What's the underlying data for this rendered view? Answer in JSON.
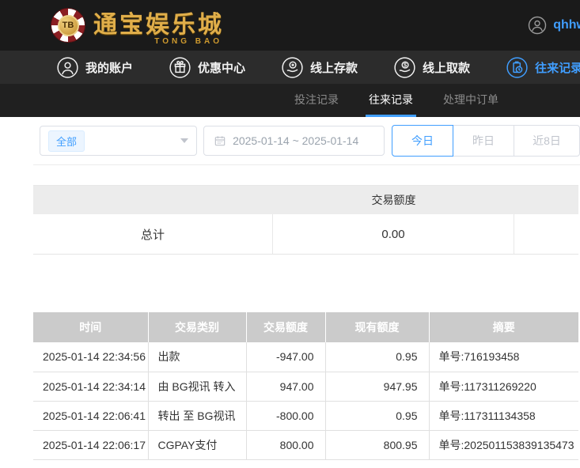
{
  "colors": {
    "accent": "#409eff",
    "gold": "#e0ae4a",
    "table_header_bg": "#cbcbcb",
    "summary_header_bg": "#ececec",
    "dark_header_bg": "#1a1a1a"
  },
  "header": {
    "logo": {
      "chip_text": "TB",
      "title": "通宝娱乐城",
      "subtitle": "TONG BAO"
    },
    "username": "qhhw"
  },
  "nav": {
    "items": [
      {
        "label": "我的账户",
        "icon": "user-icon"
      },
      {
        "label": "优惠中心",
        "icon": "gift-icon"
      },
      {
        "label": "线上存款",
        "icon": "deposit-icon"
      },
      {
        "label": "线上取款",
        "icon": "withdraw-icon"
      },
      {
        "label": "往来记录",
        "icon": "records-icon"
      }
    ],
    "bell_icon": "bell-icon"
  },
  "subtabs": [
    {
      "label": "投注记录"
    },
    {
      "label": "往来记录"
    },
    {
      "label": "处理中订单"
    }
  ],
  "filters": {
    "type_selected": "全部",
    "date_range": "2025-01-14 ~ 2025-01-14",
    "quick_buttons": [
      {
        "label": "今日",
        "active": true
      },
      {
        "label": "昨日",
        "active": false
      },
      {
        "label": "近8日",
        "active": false
      }
    ]
  },
  "summary": {
    "header": "交易额度",
    "row_label": "总计",
    "total": "0.00"
  },
  "table": {
    "columns": [
      "时间",
      "交易类别",
      "交易额度",
      "现有额度",
      "摘要"
    ],
    "rows": [
      [
        "2025-01-14 22:34:56",
        "出款",
        "-947.00",
        "0.95",
        "单号:716193458"
      ],
      [
        "2025-01-14 22:34:14",
        "由 BG视讯 转入",
        "947.00",
        "947.95",
        "单号:117311269220"
      ],
      [
        "2025-01-14 22:06:41",
        "转出 至 BG视讯",
        "-800.00",
        "0.95",
        "单号:117311134358"
      ],
      [
        "2025-01-14 22:06:17",
        "CGPAY支付",
        "800.00",
        "800.95",
        "单号:202501153839135473"
      ]
    ]
  }
}
